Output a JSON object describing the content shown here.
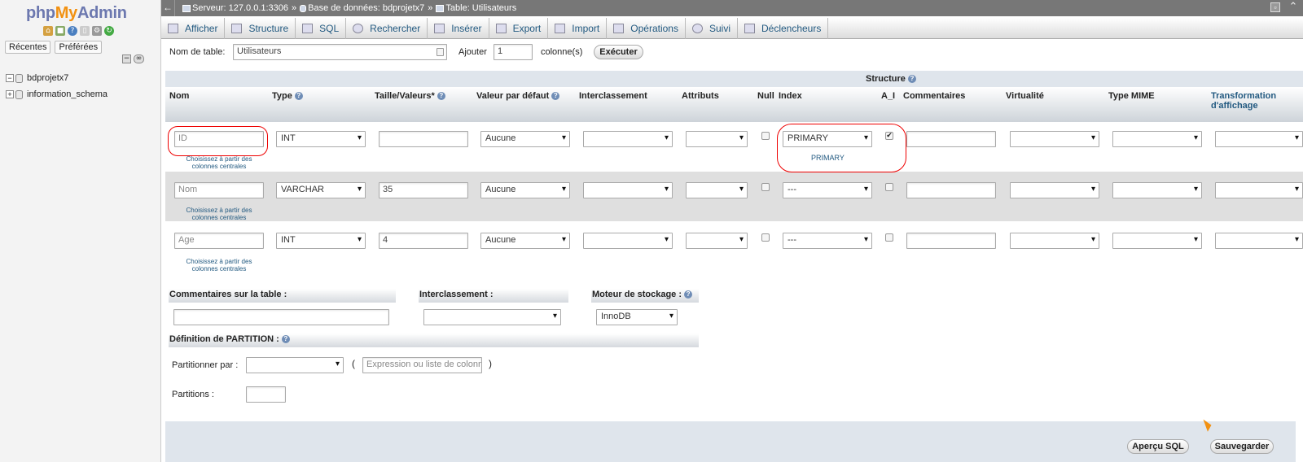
{
  "sidebar": {
    "logo": {
      "php": "php",
      "my": "My",
      "admin": "Admin"
    },
    "tabs": [
      "Récentes",
      "Préférées"
    ],
    "databases": [
      "bdprojetx7",
      "information_schema"
    ]
  },
  "topbar": {
    "back": "←",
    "server": "Serveur: 127.0.0.1:3306",
    "sep1": "»",
    "database": "Base de données: bdprojetx7",
    "sep2": "»",
    "table": "Table: Utilisateurs"
  },
  "menu": [
    "Afficher",
    "Structure",
    "SQL",
    "Rechercher",
    "Insérer",
    "Export",
    "Import",
    "Opérations",
    "Suivi",
    "Déclencheurs"
  ],
  "tablename": {
    "label": "Nom de table:",
    "value": "Utilisateurs",
    "add_label": "Ajouter",
    "add_value": "1",
    "columns_label": "colonne(s)",
    "execute": "Exécuter"
  },
  "structure": {
    "title": "Structure",
    "headers": {
      "name": "Nom",
      "type": "Type",
      "length": "Taille/Valeurs*",
      "default": "Valeur par défaut",
      "collation": "Interclassement",
      "attributes": "Attributs",
      "null": "Null",
      "index": "Index",
      "ai": "A_I",
      "comments": "Commentaires",
      "virtuality": "Virtualité",
      "mime": "Type MIME",
      "transformation": "Transformation d'affichage"
    },
    "central_hint": "Choisissez à partir des colonnes centrales",
    "rows": [
      {
        "name": "ID",
        "type": "INT",
        "length": "",
        "default": "Aucune",
        "index": "PRIMARY",
        "index_hint": "PRIMARY",
        "ai": "✔"
      },
      {
        "name": "Nom",
        "type": "VARCHAR",
        "length": "35",
        "default": "Aucune",
        "index": "---",
        "index_hint": "",
        "ai": ""
      },
      {
        "name": "Age",
        "type": "INT",
        "length": "4",
        "default": "Aucune",
        "index": "---",
        "index_hint": "",
        "ai": ""
      }
    ]
  },
  "table_options": {
    "comments_label": "Commentaires sur la table :",
    "collation_label": "Interclassement :",
    "engine_label": "Moteur de stockage :",
    "engine_value": "InnoDB"
  },
  "partition": {
    "title": "Définition de PARTITION :",
    "by_label": "Partitionner par :",
    "expr_placeholder": "Expression ou liste de colonnes",
    "open_paren": "(",
    "close_paren": ")",
    "partitions_label": "Partitions :"
  },
  "footer": {
    "preview": "Aperçu SQL",
    "save": "Sauvegarder"
  },
  "colors": {
    "accent": "#235a81",
    "annotation": "#e00000",
    "topbar": "#777777"
  }
}
